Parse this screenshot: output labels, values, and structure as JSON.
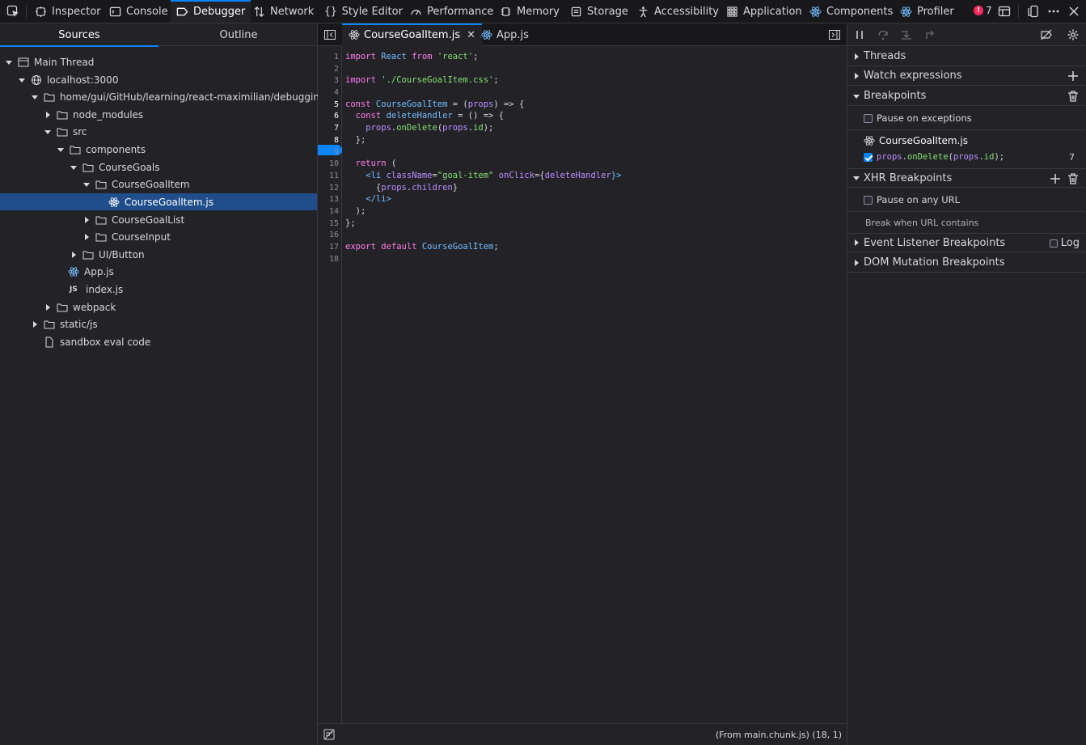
{
  "toolbar": {
    "tabs": [
      {
        "label": "Inspector"
      },
      {
        "label": "Console"
      },
      {
        "label": "Debugger"
      },
      {
        "label": "Network"
      },
      {
        "label": "Style Editor"
      },
      {
        "label": "Performance"
      },
      {
        "label": "Memory"
      },
      {
        "label": "Storage"
      },
      {
        "label": "Accessibility"
      },
      {
        "label": "Application"
      },
      {
        "label": "Components"
      },
      {
        "label": "Profiler"
      }
    ],
    "error_count": "7",
    "active_tab": "Debugger"
  },
  "left": {
    "tabs": [
      "Sources",
      "Outline"
    ],
    "tree": [
      {
        "label": "Main Thread"
      },
      {
        "label": "localhost:3000"
      },
      {
        "label": "home/gui/GitHub/learning/react-maximilian/debugging"
      },
      {
        "label": "node_modules"
      },
      {
        "label": "src"
      },
      {
        "label": "components"
      },
      {
        "label": "CourseGoals"
      },
      {
        "label": "CourseGoalItem"
      },
      {
        "label": "CourseGoalItem.js"
      },
      {
        "label": "CourseGoalList"
      },
      {
        "label": "CourseInput"
      },
      {
        "label": "UI/Button"
      },
      {
        "label": "App.js"
      },
      {
        "label": "index.js"
      },
      {
        "label": "webpack"
      },
      {
        "label": "static/js"
      },
      {
        "label": "sandbox eval code"
      }
    ],
    "js_badge": "JS"
  },
  "editor": {
    "tabs": [
      {
        "label": "CourseGoalItem.js"
      },
      {
        "label": "App.js"
      }
    ],
    "close_glyph": "✕",
    "line_numbers": [
      "1",
      "2",
      "3",
      "4",
      "5",
      "6",
      "7",
      "8",
      "9",
      "10",
      "11",
      "12",
      "13",
      "14",
      "15",
      "16",
      "17",
      "18"
    ],
    "breakpoint_line": "7",
    "footer_source": "(From main.chunk.js)  (18, 1)",
    "code": {
      "l1_kw": "import",
      "l1_id": " React ",
      "l1_kw2": "from",
      "l1_str": " 'react'",
      "l1_end": ";",
      "l3_kw": "import",
      "l3_str": " './CourseGoalItem.css'",
      "l3_end": ";",
      "l5_kw": "const",
      "l5_id": " CourseGoalItem",
      "l5_a": " = (",
      "l5_p": "props",
      "l5_b": ") => {",
      "l6_kw": "  const",
      "l6_id": " deleteHandler",
      "l6_a": " = () => {",
      "l7_p": "    props",
      "l7_a": ".",
      "l7_fn": "onDelete",
      "l7_b": "(",
      "l7_p2": "props",
      "l7_c": ".",
      "l7_p3": "id",
      "l7_d": ");",
      "l8": "  };",
      "l10_kw": "  return",
      "l10_a": " (",
      "l11_t": "    <li",
      "l11_at": " className",
      "l11_eq": "=",
      "l11_str": "\"goal-item\"",
      "l11_at2": " onClick",
      "l11_eq2": "={",
      "l11_p": "deleteHandler",
      "l11_end": "}>",
      "l12_a": "      {",
      "l12_p": "props",
      "l12_b": ".",
      "l12_p2": "children",
      "l12_c": "}",
      "l13": "    </li>",
      "l14": "  );",
      "l15": "};",
      "l17_kw": "export",
      "l17_kw2": " default",
      "l17_id": " CourseGoalItem",
      "l17_end": ";"
    }
  },
  "right": {
    "sections": {
      "threads": "Threads",
      "watch": "Watch expressions",
      "breakpoints": "Breakpoints",
      "xhr": "XHR Breakpoints",
      "event": "Event Listener Breakpoints",
      "dom": "DOM Mutation Breakpoints"
    },
    "pause_on_exceptions": "Pause on exceptions",
    "bp_file": "CourseGoalItem.js",
    "bp_code": {
      "a": "props",
      "b": ".",
      "c": "onDelete",
      "d": "(",
      "e": "props",
      "f": ".",
      "g": "id",
      "h": ");"
    },
    "bp_line": "7",
    "pause_any_url": "Pause on any URL",
    "break_when_url": "Break when URL contains",
    "log_label": "Log"
  },
  "colors": {
    "accent": "#0a84ff",
    "error": "#ff2a5a",
    "selected_row": "#204e8a"
  }
}
